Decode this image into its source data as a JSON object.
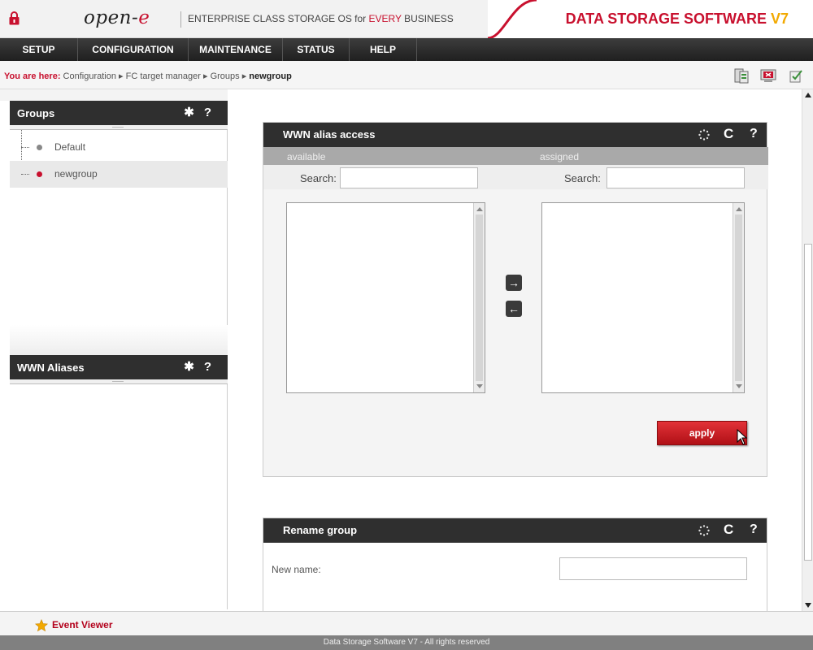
{
  "header": {
    "logo_text": "open-",
    "logo_accent": "e",
    "tagline_pre": "ENTERPRISE CLASS STORAGE OS for ",
    "tagline_accent": "EVERY",
    "tagline_post": " BUSINESS",
    "product_title": "DATA STORAGE SOFTWARE ",
    "product_version": "V7"
  },
  "menu": [
    "SETUP",
    "CONFIGURATION",
    "MAINTENANCE",
    "STATUS",
    "HELP"
  ],
  "breadcrumb": {
    "label": "You are here:",
    "path": " Configuration ▸ FC target manager ▸ Groups ▸ ",
    "current": "newgroup"
  },
  "sidebar": {
    "groups_title": "Groups",
    "groups": [
      {
        "label": "Default",
        "color": "#888888",
        "selected": false
      },
      {
        "label": "newgroup",
        "color": "#c8102e",
        "selected": true
      }
    ],
    "aliases_title": "WWN Aliases"
  },
  "wwn_card": {
    "title": "WWN alias access",
    "available_label": "available",
    "assigned_label": "assigned",
    "search_label": "Search:",
    "apply_label": "apply"
  },
  "rename_card": {
    "title": "Rename group",
    "new_name_label": "New name:"
  },
  "event_viewer": "Event Viewer",
  "footer": "Data Storage Software V7 - All rights reserved",
  "colors": {
    "accent": "#c8102e",
    "dark": "#2f2f2f",
    "version": "#f2a900"
  }
}
